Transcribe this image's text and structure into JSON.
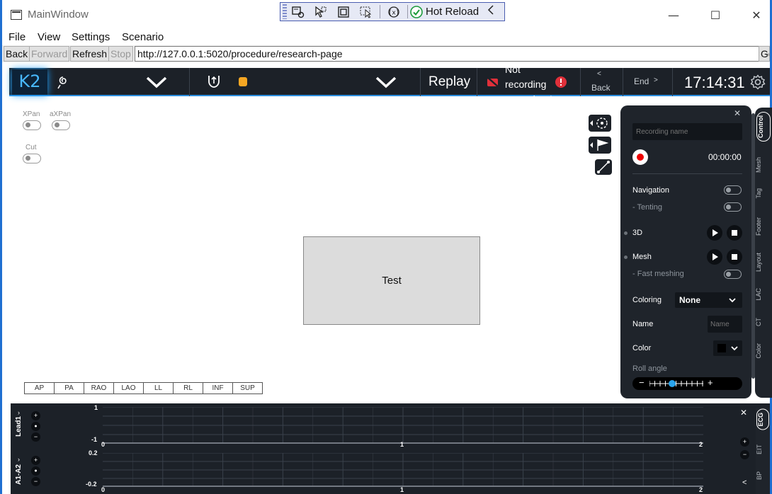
{
  "window": {
    "title": "MainWindow",
    "minimize": "—",
    "maximize": "☐",
    "close": "✕"
  },
  "hot_reload_toolbar": {
    "label": "Hot Reload"
  },
  "menu": {
    "items": [
      "File",
      "View",
      "Settings",
      "Scenario"
    ]
  },
  "address_bar": {
    "back": "Back",
    "forward": "Forward",
    "refresh": "Refresh",
    "stop": "Stop",
    "url": "http://127.0.0.1:5020/procedure/research-page",
    "go": "Go"
  },
  "app_header": {
    "logo": "K2",
    "replay": "Replay",
    "recording_status": "Not recording procedure!",
    "back_arrow": "<",
    "back": "Back",
    "end": "End",
    "end_arrow": ">",
    "time": "17:14:31",
    "status_dot_color": "#f5a623"
  },
  "left_controls": {
    "xpan": "XPan",
    "axpan": "aXPan",
    "cut": "Cut"
  },
  "canvas": {
    "test_label": "Test"
  },
  "view_buttons": [
    "AP",
    "PA",
    "RAO",
    "LAO",
    "LL",
    "RL",
    "INF",
    "SUP"
  ],
  "control_panel": {
    "recording_name_placeholder": "Recording name",
    "record_time": "00:00:00",
    "navigation": "Navigation",
    "tenting": "- Tenting",
    "three_d": "3D",
    "mesh": "Mesh",
    "fast_meshing": "- Fast meshing",
    "coloring": "Coloring",
    "coloring_value": "None",
    "name": "Name",
    "name_placeholder": "Name",
    "color": "Color",
    "roll_angle": "Roll angle",
    "roll_minus": "−",
    "roll_plus": "+",
    "roll_value_fraction": 0.42
  },
  "right_tabs": [
    "Control",
    "Mesh",
    "Tag",
    "Footer",
    "Layout",
    "LAC",
    "CT",
    "Color"
  ],
  "ecg": {
    "tabs": [
      "ECG",
      "EIT",
      "BP"
    ],
    "leads": [
      {
        "name": "Lead1",
        "y_max": "1",
        "y_min": "-1"
      },
      {
        "name": "A1-A2",
        "y_max": "0.2",
        "y_min": "-0.2"
      }
    ],
    "x_ticks": [
      "0",
      "1",
      "2"
    ],
    "ctrl_plus": "+",
    "ctrl_dot": "●",
    "ctrl_minus": "−",
    "close": "✕",
    "collapse": "<"
  }
}
